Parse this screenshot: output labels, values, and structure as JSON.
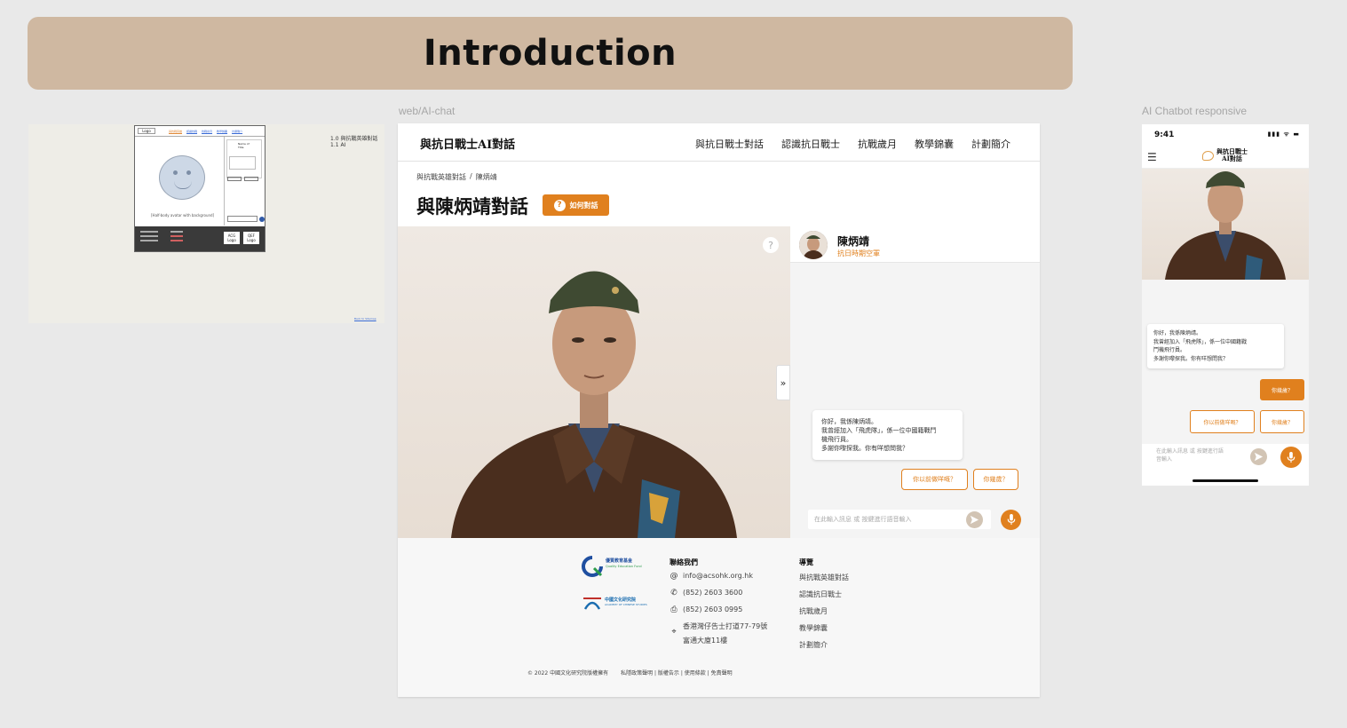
{
  "banner": {
    "title": "Introduction"
  },
  "labels": {
    "web": "web/AI-chat",
    "responsive": "AI Chatbot responsive"
  },
  "wireframe": {
    "logo": "Logo",
    "nav": [
      "與抗戰英雄",
      "認識抗戰",
      "抗戰歲月",
      "教學錦囊",
      "計劃簡介"
    ],
    "avatar_caption": "[Half-body avatar with background]",
    "name": "Name of",
    "role": "Title",
    "footer_logo_1": "ACG Logo",
    "footer_logo_2": "QEF Logo",
    "note_line1": "1.0 與抗戰英雄對話",
    "note_line2": "1.1 AI",
    "link": "Back to Sitemap"
  },
  "web": {
    "brand": "與抗日戰士AI對話",
    "menu": [
      "與抗日戰士對話",
      "認識抗日戰士",
      "抗戰歲月",
      "教學錦囊",
      "計劃簡介"
    ],
    "breadcrumb": [
      "與抗戰英雄對話",
      "/",
      "陳炳靖"
    ],
    "title": "與陳炳靖對話",
    "how_button": "如何對話",
    "help_icon": "?",
    "collapse_icon": "»",
    "chat": {
      "name": "陳炳靖",
      "role": "抗日時期空軍",
      "bot_lines": [
        "你好，我係陳炳靖。",
        "我曾經加入「飛虎隊」，係一位中國籍戰鬥",
        "機飛行員。",
        "多謝你嚟探我。你有咩想問我？"
      ],
      "chips": [
        "你以前做咩嘅？",
        "你幾歲？"
      ],
      "input_placeholder": "在此輸入訊息 或 按鍵進行語音輸入"
    },
    "footer": {
      "qef_cn": "優質教育基金",
      "qef_en": "Quality Education Fund",
      "cci_cn": "中國文化研究院",
      "cci_en": "ACADEMY OF CHINESE STUDIES",
      "contact_title": "聯絡我們",
      "email": "info@acsohk.org.hk",
      "phone": "(852) 2603 3600",
      "fax": "(852) 2603 0995",
      "address_1": "香港灣仔告士打道77-79號",
      "address_2": "富通大廈11樓",
      "guide_title": "導覽",
      "guide_links": [
        "與抗戰英雄對話",
        "認識抗日戰士",
        "抗戰歲月",
        "教學錦囊",
        "計劃簡介"
      ],
      "copyright": "© 2022 中國文化研究院版權擁有",
      "legal": "私隱政策聲明 | 版權告示 | 使用條款 | 免責聲明"
    }
  },
  "phone": {
    "time": "9:41",
    "status_icons": "▮▮▮ ᯤ ▬",
    "brand_line1": "與抗日戰士",
    "brand_line2": "AI對話",
    "bot_lines": [
      "你好，我係陳炳靖。",
      "我曾經加入「飛虎隊」，係一位中國籍戰",
      "鬥機飛行員。",
      "多謝你嚟探我。你有咩想問我？"
    ],
    "user_msg": "你幾歲？",
    "chips": [
      "你以前做咩嘅？",
      "你幾歲？"
    ],
    "input_line1": "在此輸入訊息 或 按鍵進行語",
    "input_line2": "音輸入"
  },
  "colors": {
    "accent": "#e0801e",
    "banner": "#cfb8a1",
    "canvas": "#e9e9e9"
  },
  "icons": [
    "help-icon",
    "send-icon",
    "mic-icon",
    "email-icon",
    "phone-icon",
    "fax-icon",
    "location-icon",
    "menu-icon",
    "chat-bubble-icon"
  ]
}
